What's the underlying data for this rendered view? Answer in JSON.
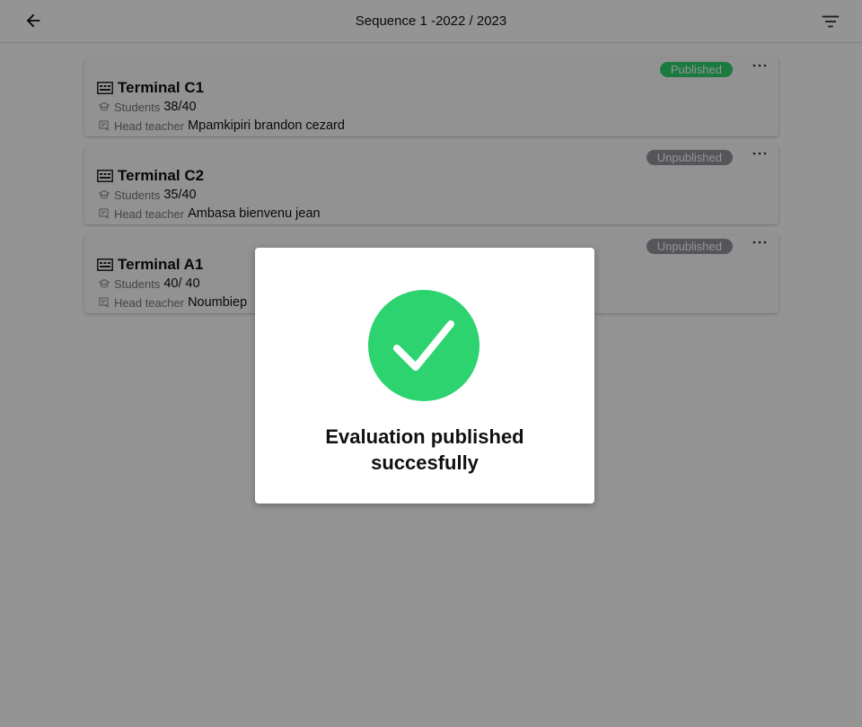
{
  "header": {
    "title": "Sequence 1 -2022 / 2023",
    "back_icon": "arrow-left-icon",
    "filter_icon": "filter-icon"
  },
  "labels": {
    "students": "Students",
    "head_teacher": "Head teacher"
  },
  "classes": [
    {
      "name": "Terminal C1",
      "students": "38/40",
      "head_teacher": "Mpamkipiri brandon cezard",
      "status": "Published"
    },
    {
      "name": "Terminal C2",
      "students": "35/40",
      "head_teacher": "Ambasa bienvenu jean",
      "status": "Unpublished"
    },
    {
      "name": "Terminal A1",
      "students": "40/ 40",
      "head_teacher": "Noumbiep",
      "status": "Unpublished"
    }
  ],
  "colors": {
    "published": "#2dd36f",
    "unpublished": "#92949c",
    "success": "#2dd36f"
  },
  "dialog": {
    "message_line1": "Evaluation published",
    "message_line2": "succesfully",
    "icon": "check-circle-icon"
  }
}
